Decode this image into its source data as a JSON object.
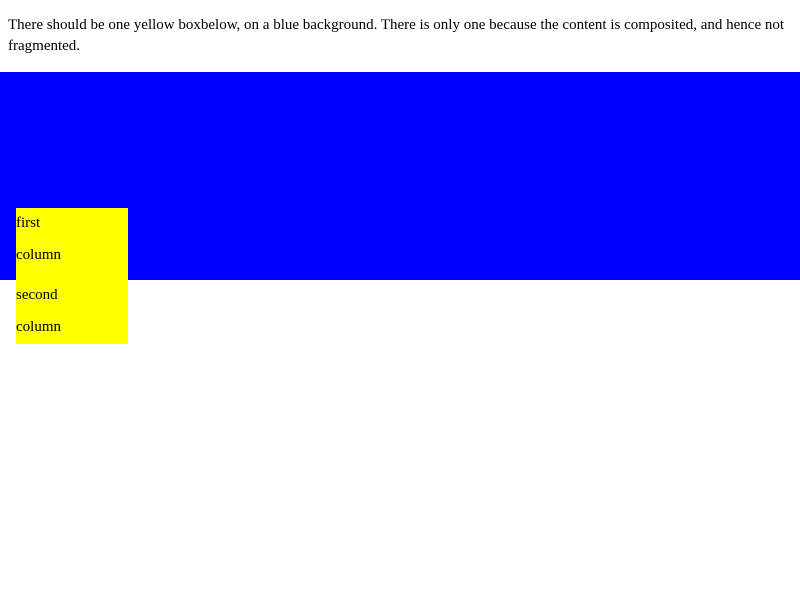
{
  "description_text": "There should be one yellow boxbelow, on a blue background. There is only one because the content is composited, and hence not fragmented.",
  "columns": {
    "first": [
      "first",
      "column"
    ],
    "second": [
      "second",
      "column"
    ]
  },
  "colors": {
    "background": "#0000ff",
    "box": "#ffff00",
    "page": "#ffffff"
  }
}
